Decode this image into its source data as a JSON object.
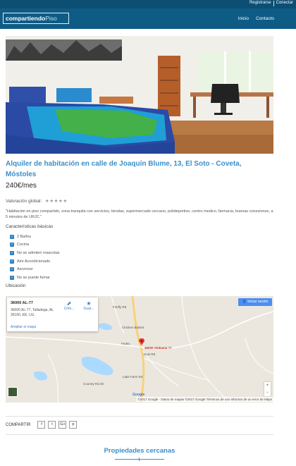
{
  "topbar": {
    "register": "Registrarse",
    "login": "Conectar"
  },
  "header": {
    "logo_bold": "compartiendo",
    "logo_light": "Piso",
    "nav": {
      "home": "Inicio",
      "contact": "Contacto"
    }
  },
  "listing": {
    "title": "Alquiler de habitación en calle de Joaquín Blume, 13, El Soto - Coveta, Móstoles",
    "price": "240€/mes",
    "rating_label": "Valoración global:",
    "rating_stars": "★★★★★",
    "description": "\"Habitación en piso compartido, zona tranquila con servicios, tiendas, supermercado cercano, polideportivo, centro medico, farmacia, buenas conexiones, a 5 minutos de URJC.\"",
    "features_title": "Características básicas",
    "features": [
      "2 Baños",
      "Cocina",
      "No se admiten mascotas",
      "Aire Acondicionado",
      "Ascensor",
      "No se puede fumar"
    ],
    "location_title": "Ubicación"
  },
  "map": {
    "place_name": "36000 AL-77",
    "address": "36000 AL-77, Talladega, AL 35160, EE. UU.",
    "enlarge": "Ampliar el mapa",
    "directions": "Cóm...",
    "save": "Guar...",
    "sign_in": "Iniciar sesión",
    "pin_label": "36000 Alabama 77",
    "labels": [
      "Chicken Basket",
      "Firefly Rd",
      "Dust Rd",
      "Lake Farm Rd",
      "Country Rd 36",
      "Fedex"
    ],
    "google": "Google",
    "attribution": "©2017 Google · Datos de mapas ©2017 Google   Términos de uso   Informar de un error de Maps",
    "zoom_in": "+",
    "zoom_out": "−"
  },
  "share": {
    "label": "COMPARTIR",
    "buttons": [
      "f",
      "t",
      "G+",
      "p"
    ]
  },
  "nearby": {
    "title": "Propiedades cercanas"
  }
}
